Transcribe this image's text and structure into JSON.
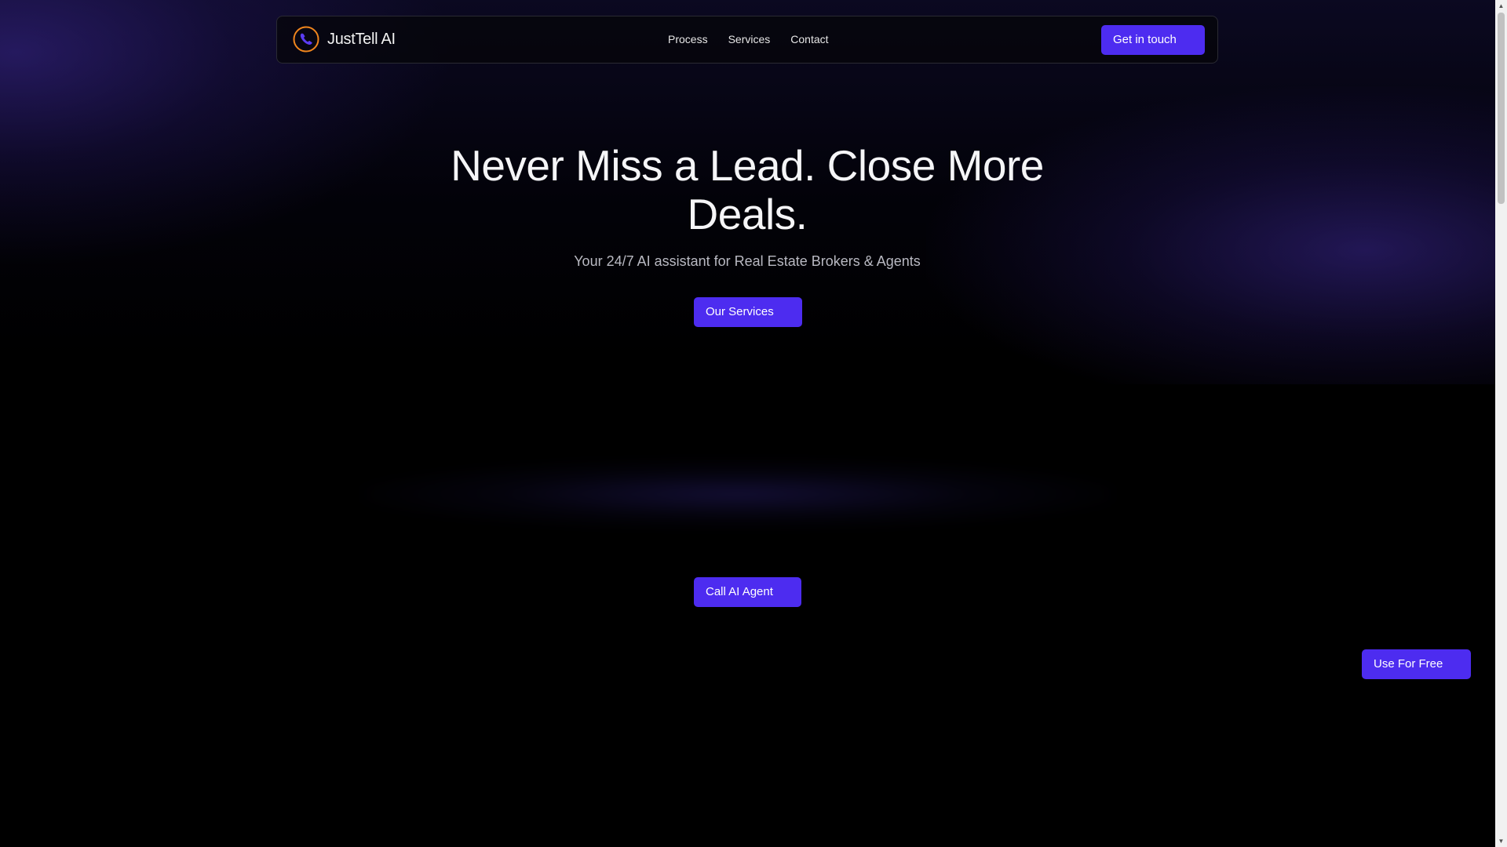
{
  "brand": {
    "name": "JustTell AI",
    "logo_icon": "phone-icon",
    "logo_ring_color": "#f0851d",
    "logo_phone_color": "#5b3cf4"
  },
  "nav": {
    "links": [
      "Process",
      "Services",
      "Contact"
    ],
    "cta_label": "Get in touch"
  },
  "hero": {
    "title": "Never Miss a Lead. Close More Deals.",
    "subtitle": "Your 24/7 AI assistant for Real Estate Brokers & Agents",
    "services_button": "Our Services"
  },
  "call": {
    "button": "Call AI Agent"
  },
  "floating": {
    "button": "Use For Free"
  },
  "theme": {
    "background": "#000000",
    "accent": "#4d2cf0",
    "glow": "#3c2896"
  }
}
